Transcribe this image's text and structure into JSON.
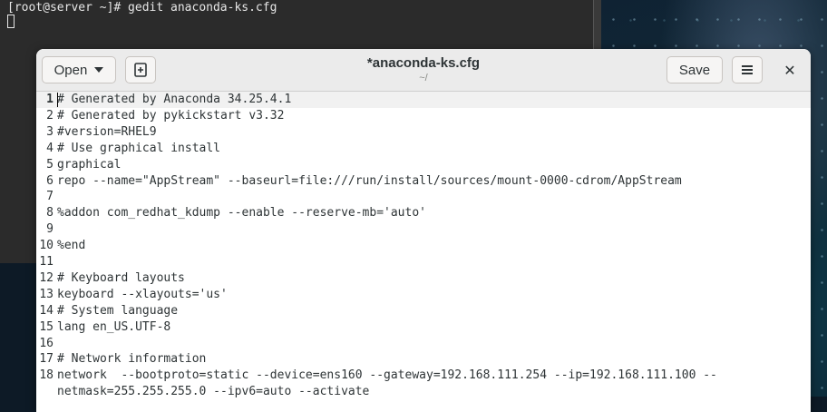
{
  "terminal": {
    "prompt_line": "[root@server ~]# gedit anaconda-ks.cfg"
  },
  "gedit": {
    "title": "*anaconda-ks.cfg",
    "subtitle": "~/",
    "open_label": "Open",
    "save_label": "Save",
    "close_glyph": "✕",
    "new_doc_glyph": "+"
  },
  "editor": {
    "current_line": 1,
    "lines": [
      {
        "num": "1",
        "text": "# Generated by Anaconda 34.25.4.1"
      },
      {
        "num": "2",
        "text": "# Generated by pykickstart v3.32"
      },
      {
        "num": "3",
        "text": "#version=RHEL9"
      },
      {
        "num": "4",
        "text": "# Use graphical install"
      },
      {
        "num": "5",
        "text": "graphical"
      },
      {
        "num": "6",
        "text": "repo --name=\"AppStream\" --baseurl=file:///run/install/sources/mount-0000-cdrom/AppStream"
      },
      {
        "num": "7",
        "text": ""
      },
      {
        "num": "8",
        "text": "%addon com_redhat_kdump --enable --reserve-mb='auto'"
      },
      {
        "num": "9",
        "text": ""
      },
      {
        "num": "10",
        "text": "%end"
      },
      {
        "num": "11",
        "text": ""
      },
      {
        "num": "12",
        "text": "# Keyboard layouts"
      },
      {
        "num": "13",
        "text": "keyboard --xlayouts='us'"
      },
      {
        "num": "14",
        "text": "# System language"
      },
      {
        "num": "15",
        "text": "lang en_US.UTF-8"
      },
      {
        "num": "16",
        "text": ""
      },
      {
        "num": "17",
        "text": "# Network information"
      },
      {
        "num": "18",
        "text": "network  --bootproto=static --device=ens160 --gateway=192.168.111.254 --ip=192.168.111.100 --"
      },
      {
        "num": "",
        "text": "netmask=255.255.255.0 --ipv6=auto --activate"
      }
    ]
  }
}
